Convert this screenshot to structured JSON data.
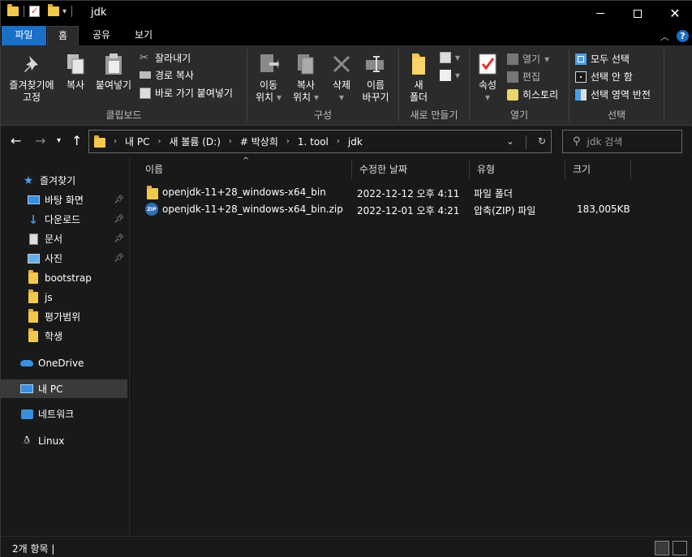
{
  "window": {
    "title": "jdk"
  },
  "tabs": {
    "file": "파일",
    "home": "홈",
    "share": "공유",
    "view": "보기"
  },
  "ribbon": {
    "clipboard": {
      "label": "클립보드",
      "pin_line1": "즐겨찾기에",
      "pin_line2": "고정",
      "copy": "복사",
      "paste": "붙여넣기",
      "cut": "잘라내기",
      "copy_path": "경로 복사",
      "paste_shortcut": "바로 가기 붙여넣기"
    },
    "organize": {
      "label": "구성",
      "move_line1": "이동",
      "move_line2": "위치",
      "copy_line1": "복사",
      "copy_line2": "위치",
      "delete": "삭제",
      "rename_line1": "이름",
      "rename_line2": "바꾸기"
    },
    "new": {
      "label": "새로 만들기",
      "folder_line1": "새",
      "folder_line2": "폴더"
    },
    "open": {
      "label": "열기",
      "properties": "속성",
      "open": "열기",
      "edit": "편집",
      "history": "히스토리"
    },
    "select": {
      "label": "선택",
      "select_all": "모두 선택",
      "select_none": "선택 안 함",
      "invert": "선택 영역 반전"
    }
  },
  "address": {
    "crumbs": [
      "내 PC",
      "새 볼륨 (D:)",
      "# 박상희",
      "1. tool",
      "jdk"
    ]
  },
  "search": {
    "placeholder": "jdk 검색"
  },
  "navpane": {
    "quick_access": "즐겨찾기",
    "items": [
      {
        "label": "바탕 화면",
        "icon": "desktop-icon",
        "pinned": true
      },
      {
        "label": "다운로드",
        "icon": "download-icon",
        "pinned": true
      },
      {
        "label": "문서",
        "icon": "document-icon",
        "pinned": true
      },
      {
        "label": "사진",
        "icon": "pictures-icon",
        "pinned": true
      },
      {
        "label": "bootstrap",
        "icon": "folder-icon",
        "pinned": false
      },
      {
        "label": "js",
        "icon": "folder-icon",
        "pinned": false
      },
      {
        "label": "평가범위",
        "icon": "folder-icon",
        "pinned": false
      },
      {
        "label": "학생",
        "icon": "folder-icon",
        "pinned": false
      }
    ],
    "onedrive": "OneDrive",
    "this_pc": "내 PC",
    "network": "네트워크",
    "linux": "Linux"
  },
  "columns": {
    "name": "이름",
    "modified": "수정한 날짜",
    "type": "유형",
    "size": "크기"
  },
  "files": [
    {
      "name": "openjdk-11+28_windows-x64_bin",
      "modified": "2022-12-12 오후 4:11",
      "type": "파일 폴더",
      "size": "",
      "icon": "folder-icon"
    },
    {
      "name": "openjdk-11+28_windows-x64_bin.zip",
      "modified": "2022-12-01 오후 4:21",
      "type": "압축(ZIP) 파일",
      "size": "183,005KB",
      "icon": "zip-icon"
    }
  ],
  "status": {
    "count": "2개 항목"
  },
  "colors": {
    "accent": "#1a6fc9",
    "folder": "#f2c94c",
    "background": "#191919",
    "ribbon": "#2b2b2b"
  }
}
